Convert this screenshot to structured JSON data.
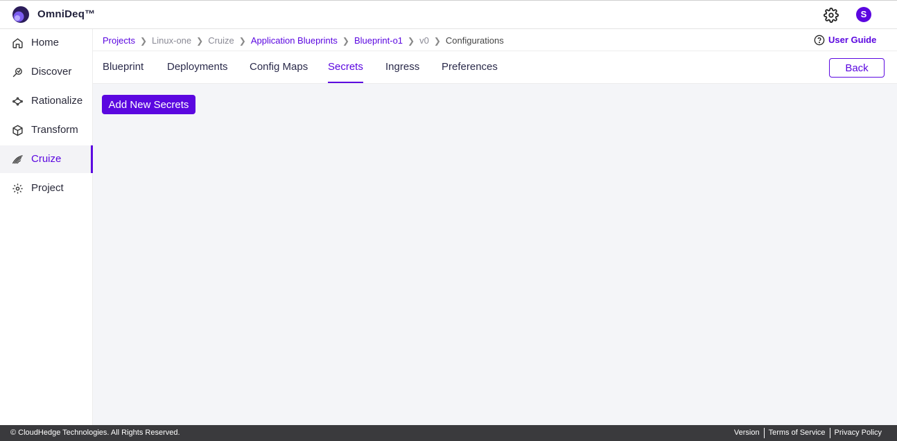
{
  "app": {
    "name": "OmniDeq™",
    "avatar_letter": "S",
    "accent_color": "#5b07e0"
  },
  "sidebar": {
    "items": [
      {
        "label": "Home",
        "icon": "home-icon"
      },
      {
        "label": "Discover",
        "icon": "discover-icon"
      },
      {
        "label": "Rationalize",
        "icon": "rationalize-icon"
      },
      {
        "label": "Transform",
        "icon": "cube-icon"
      },
      {
        "label": "Cruize",
        "icon": "cruize-icon",
        "active": true
      },
      {
        "label": "Project",
        "icon": "gear-icon"
      }
    ]
  },
  "breadcrumb": [
    "Projects",
    "Linux-one",
    "Cruize",
    "Application Blueprints",
    "Blueprint-o1",
    "v0",
    "Configurations"
  ],
  "user_guide": "User Guide",
  "tabs": [
    "Blueprint",
    "Deployments",
    "Config Maps",
    "Secrets",
    "Ingress",
    "Preferences"
  ],
  "active_tab": "Secrets",
  "back_label": "Back",
  "add_button_label": "Add New Secrets",
  "footer": {
    "copyright": "© CloudHedge Technologies. All Rights Reserved.",
    "links": [
      "Version",
      "Terms of Service",
      "Privacy Policy"
    ]
  }
}
